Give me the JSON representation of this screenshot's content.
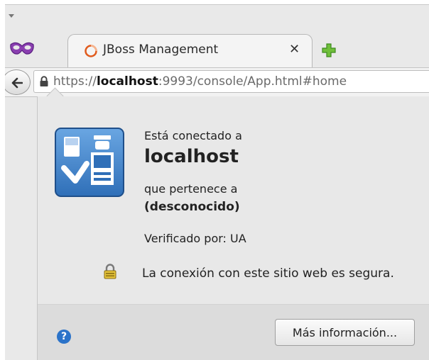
{
  "browser": {
    "tab": {
      "title": "JBoss Management"
    },
    "tab_close_symbol": "✕",
    "url": {
      "scheme": "https://",
      "host": "localhost",
      "rest": ":9993/console/App.html#home"
    }
  },
  "identity_panel": {
    "connected_to_label": "Está conectado a",
    "host": "localhost",
    "belongs_to_label": "que pertenece a",
    "owner": "(desconocido)",
    "verified_by": "Verificado por: UA",
    "secure_message": "La conexión con este sitio web es segura.",
    "help_symbol": "?",
    "more_info_button": "Más información..."
  },
  "icons": [
    "menu-arrow-icon",
    "private-mask-icon",
    "loading-favicon-icon",
    "close-icon",
    "new-tab-icon",
    "back-arrow-icon",
    "lock-icon",
    "identity-verification-icon",
    "padlock-icon",
    "help-icon"
  ],
  "colors": {
    "accent_blue": "#2b73c9",
    "favicon_orange": "#e05a1c",
    "newtab_green": "#6fbf3a",
    "mask_purple": "#8a3fb0"
  }
}
